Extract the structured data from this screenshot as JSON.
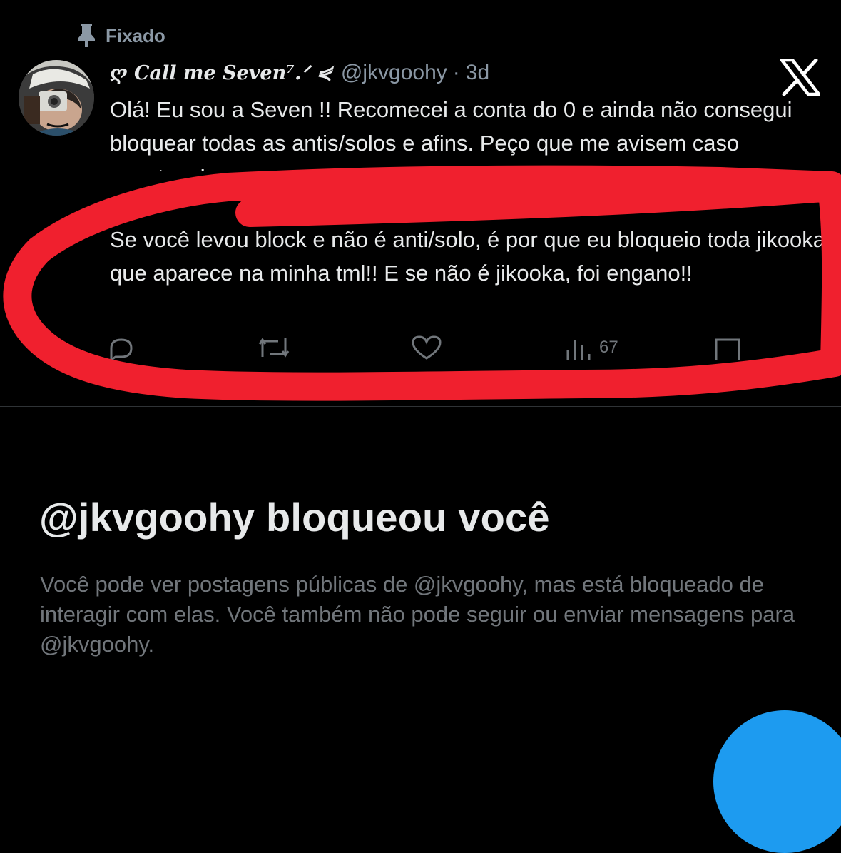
{
  "pinned": {
    "label": "Fixado",
    "icon": "pin-icon"
  },
  "tweet": {
    "display_name": "ღ Call me Seven⁷.ᐟ ⋞",
    "handle": "@jkvgoohy",
    "separator": "·",
    "time": "3d",
    "paragraph1": "Olá! Eu sou a Seven !! Recomecei a conta do 0 e ainda não consegui bloquear todas as antis/solos e afins. Peço que me avisem caso aconteça! ♥",
    "paragraph2": "Se você levou block e não é anti/solo, é por que eu bloqueio toda jikooka que aparece na minha tml!! E se não é jikooka, foi engano!!",
    "views": "67"
  },
  "blocked": {
    "title": "@jkvgoohy bloqueou você",
    "description": "Você pode ver postagens públicas de @jkvgoohy, mas está bloqueado de interagir com elas. Você também não pode seguir ou enviar mensagens para @jkvgoohy."
  },
  "colors": {
    "background": "#000000",
    "text": "#e7e9ea",
    "muted": "#71767b",
    "accent": "#1d9bf0",
    "highlight_stroke": "#f0202e"
  },
  "icons": [
    "pin-icon",
    "x-logo-icon",
    "reply-icon",
    "repost-icon",
    "like-icon",
    "views-icon",
    "share-icon"
  ]
}
